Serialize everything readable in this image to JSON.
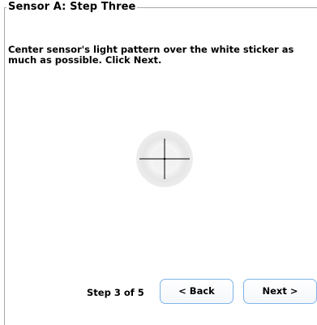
{
  "group": {
    "title": "Sensor A: Step Three"
  },
  "instruction": "Center sensor's light pattern over the white sticker as much as possible.  Click Next.",
  "target": {
    "icon": "crosshair-target-icon"
  },
  "footer": {
    "step_label": "Step 3 of 5",
    "back_label": "< Back",
    "next_label": "Next >"
  },
  "colors": {
    "button_border": "#7eb4ea",
    "frame": "#a8a8a8"
  }
}
